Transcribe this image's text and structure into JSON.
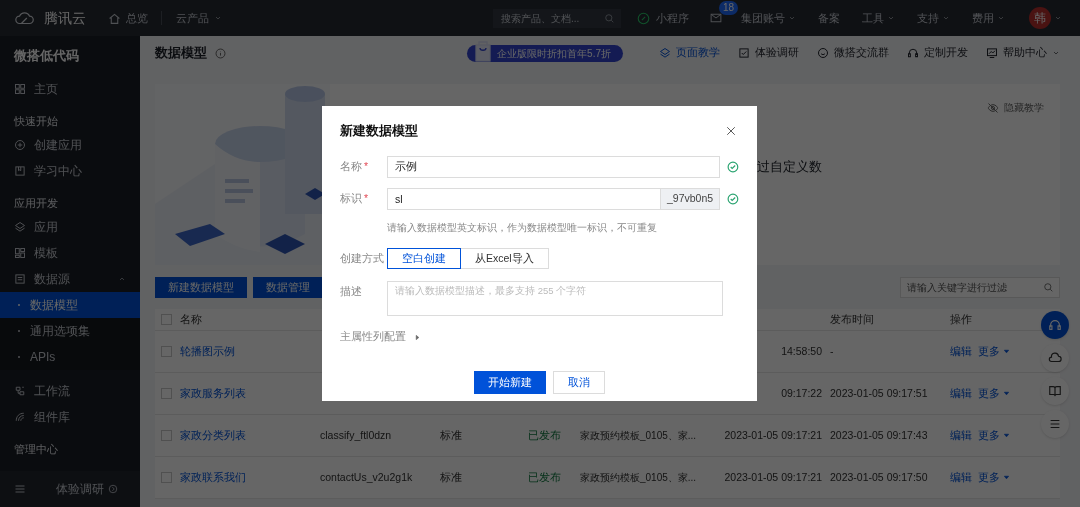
{
  "top_bar": {
    "brand": "腾讯云",
    "nav": [
      {
        "label": "总览",
        "dropdown": false
      },
      {
        "label": "云产品",
        "dropdown": true
      }
    ],
    "search": {
      "placeholder": "搜索产品、文档..."
    },
    "items": [
      {
        "kind": "app",
        "label": "小程序"
      },
      {
        "kind": "mail",
        "badge": "18"
      },
      {
        "kind": "link",
        "label": "集团账号",
        "dropdown": true
      },
      {
        "kind": "link",
        "label": "备案",
        "dropdown": false
      },
      {
        "kind": "link",
        "label": "工具",
        "dropdown": true
      },
      {
        "kind": "link",
        "label": "支持",
        "dropdown": true
      },
      {
        "kind": "link",
        "label": "费用",
        "dropdown": true
      },
      {
        "kind": "avatar",
        "label": "韩",
        "dropdown": true
      }
    ]
  },
  "sidebar": {
    "title": "微搭低代码",
    "items": [
      {
        "kind": "item",
        "label": "主页"
      },
      {
        "kind": "section",
        "label": "快速开始"
      },
      {
        "kind": "item",
        "label": "创建应用"
      },
      {
        "kind": "item",
        "label": "学习中心"
      },
      {
        "kind": "section",
        "label": "应用开发"
      },
      {
        "kind": "item",
        "label": "应用"
      },
      {
        "kind": "item",
        "label": "模板"
      },
      {
        "kind": "item",
        "label": "数据源",
        "expanded": true
      },
      {
        "kind": "sub",
        "label": "数据模型",
        "selected": true
      },
      {
        "kind": "sub",
        "label": "通用选项集",
        "selected": false
      },
      {
        "kind": "sub",
        "label": "APIs",
        "selected": false
      },
      {
        "kind": "item",
        "label": "工作流"
      },
      {
        "kind": "item",
        "label": "组件库"
      },
      {
        "kind": "section",
        "label": "管理中心"
      }
    ],
    "footer": {
      "label": "体验调研"
    }
  },
  "header": {
    "title": "数据模型",
    "promo": "企业版限时折扣首年5.7折",
    "links": [
      {
        "label": "页面教学",
        "active": true,
        "dropdown": false
      },
      {
        "label": "体验调研",
        "active": false,
        "dropdown": false
      },
      {
        "label": "微搭交流群",
        "active": false,
        "dropdown": false
      },
      {
        "label": "定制开发",
        "active": false,
        "dropdown": false
      },
      {
        "label": "帮助中心",
        "active": false,
        "dropdown": true
      }
    ]
  },
  "banner": {
    "hide_label": "隐藏教学",
    "text": "过自定义数"
  },
  "toolbar": {
    "buttons": [
      "新建数据模型",
      "数据管理"
    ],
    "search": {
      "placeholder": "请输入关键字进行过滤"
    }
  },
  "table": {
    "all_checked": false,
    "headers": {
      "name": "名称",
      "publish_time": "发布时间",
      "actions": "操作"
    },
    "rows": [
      {
        "checked": false,
        "name": "轮播图示例",
        "column_6": "14:58:50",
        "publish_time": "-",
        "actions": [
          "编辑",
          "更多"
        ]
      },
      {
        "checked": false,
        "name": "家政服务列表",
        "column_6": "09:17:22",
        "publish_time": "2023-01-05 09:17:51",
        "actions": [
          "编辑",
          "更多"
        ]
      },
      {
        "checked": false,
        "name": "家政分类列表",
        "column_2": "classify_ftl0dzn",
        "column_3": "标准",
        "status": "已发布",
        "column_5": "家政预约模板_0105、家...",
        "column_6": "2023-01-05 09:17:21",
        "publish_time": "2023-01-05 09:17:43",
        "actions": [
          "编辑",
          "更多"
        ]
      },
      {
        "checked": false,
        "name": "家政联系我们",
        "column_2": "contactUs_v2u2g1k",
        "column_3": "标准",
        "status": "已发布",
        "column_5": "家政预约模板_0105、家...",
        "column_6": "2023-01-05 09:17:21",
        "publish_time": "2023-01-05 09:17:50",
        "actions": [
          "编辑",
          "更多"
        ]
      }
    ]
  },
  "dialog": {
    "title": "新建数据模型",
    "fields": [
      {
        "kind": "input",
        "label": "名称",
        "required_mark": "*",
        "value": "示例",
        "valid": true
      },
      {
        "kind": "input",
        "label": "标识",
        "required_mark": "*",
        "value": "sl",
        "suffix": "_97vb0n5",
        "valid": true,
        "hint": "请输入数据模型英文标识，作为数据模型唯一标识，不可重复"
      },
      {
        "kind": "segmented",
        "label": "创建方式",
        "options": [
          {
            "label": "空白创建",
            "selected": true
          },
          {
            "label": "从Excel导入",
            "selected": false
          }
        ]
      },
      {
        "kind": "textarea",
        "label": "描述",
        "placeholder": "请输入数据模型描述，最多支持 255 个字符"
      }
    ],
    "advanced": {
      "label": "主属性列配置",
      "expanded": false
    },
    "buttons": [
      {
        "label": "开始新建",
        "primary": true
      },
      {
        "label": "取消",
        "primary": false
      }
    ]
  }
}
